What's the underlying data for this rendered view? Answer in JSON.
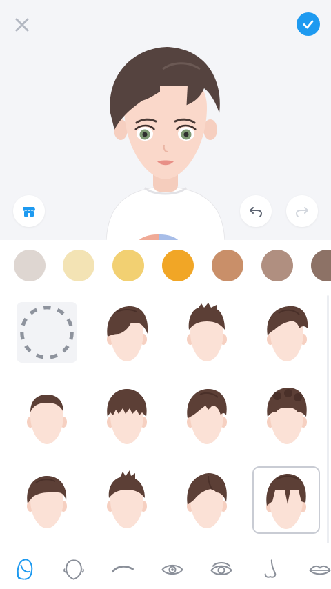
{
  "header": {
    "close_icon": "close-icon",
    "confirm_icon": "checkmark-icon",
    "accent_color": "#1e9af0"
  },
  "preview": {
    "store_icon": "store-icon",
    "undo_icon": "undo-icon",
    "redo_icon": "redo-icon"
  },
  "hair_colors": [
    {
      "name": "light-gray",
      "color": "#ded6d1"
    },
    {
      "name": "pale-blonde",
      "color": "#f3e3b4"
    },
    {
      "name": "golden-blonde",
      "color": "#f2d072"
    },
    {
      "name": "orange",
      "color": "#f1a626"
    },
    {
      "name": "light-brown",
      "color": "#c98f69"
    },
    {
      "name": "taupe",
      "color": "#b08f80"
    },
    {
      "name": "dark-taupe",
      "color": "#8d7266"
    }
  ],
  "hair_styles": {
    "selected_index": 11,
    "items": [
      {
        "style": "none"
      },
      {
        "style": "side-swept"
      },
      {
        "style": "spiky-quiff"
      },
      {
        "style": "wavy-swoop"
      },
      {
        "style": "buzz-cut"
      },
      {
        "style": "textured-fringe"
      },
      {
        "style": "messy-side"
      },
      {
        "style": "curly-top"
      },
      {
        "style": "slick-part"
      },
      {
        "style": "faux-hawk"
      },
      {
        "style": "side-part-volume"
      },
      {
        "style": "curtain-bangs"
      }
    ]
  },
  "categories": {
    "active_index": 0,
    "items": [
      {
        "icon": "hair-icon"
      },
      {
        "icon": "face-shape-icon"
      },
      {
        "icon": "eyebrow-icon"
      },
      {
        "icon": "eye-icon"
      },
      {
        "icon": "eye-detail-icon"
      },
      {
        "icon": "nose-icon"
      },
      {
        "icon": "lips-icon"
      }
    ]
  }
}
